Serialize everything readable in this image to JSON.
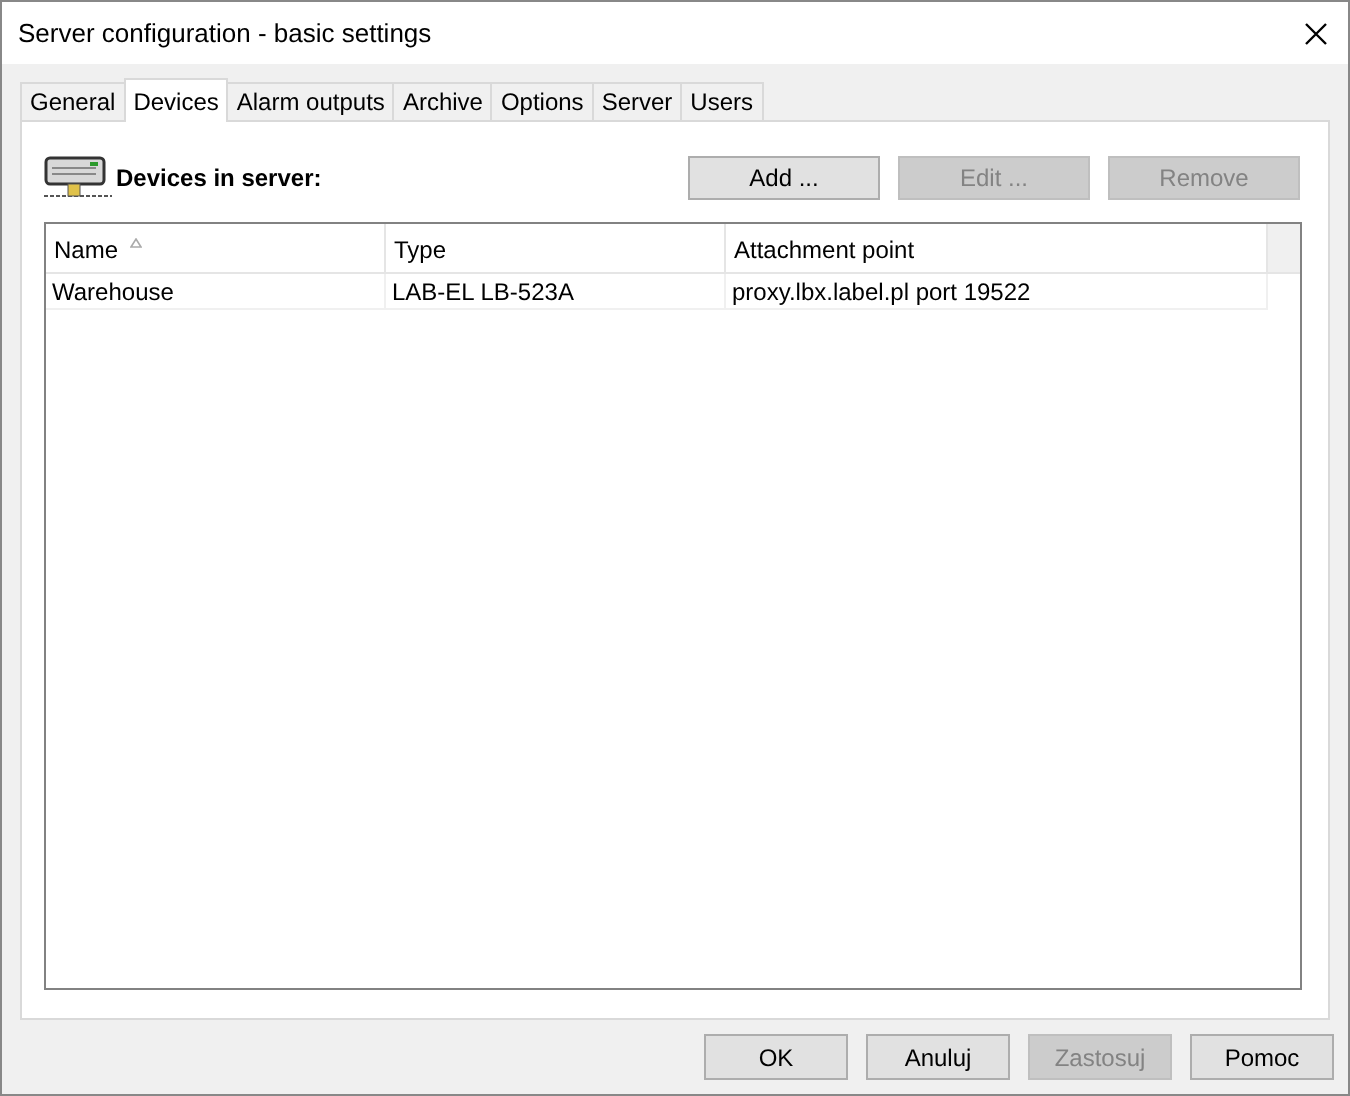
{
  "window": {
    "title": "Server configuration - basic settings"
  },
  "tabs": [
    {
      "label": "General",
      "selected": false
    },
    {
      "label": "Devices",
      "selected": true
    },
    {
      "label": "Alarm outputs",
      "selected": false
    },
    {
      "label": "Archive",
      "selected": false
    },
    {
      "label": "Options",
      "selected": false
    },
    {
      "label": "Server",
      "selected": false
    },
    {
      "label": "Users",
      "selected": false
    }
  ],
  "section_label": "Devices in server:",
  "actions": [
    {
      "label": "Add ...",
      "disabled": false
    },
    {
      "label": "Edit ...",
      "disabled": true
    },
    {
      "label": "Remove",
      "disabled": true
    }
  ],
  "table": {
    "columns": [
      {
        "label": "Name",
        "sorted": true
      },
      {
        "label": "Type",
        "sorted": false
      },
      {
        "label": "Attachment point",
        "sorted": false
      }
    ],
    "rows": [
      [
        "Warehouse",
        "LAB-EL LB-523A",
        "proxy.lbx.label.pl port 19522"
      ]
    ]
  },
  "buttons": [
    {
      "label": "OK",
      "disabled": false
    },
    {
      "label": "Anuluj",
      "disabled": false
    },
    {
      "label": "Zastosuj",
      "disabled": true
    },
    {
      "label": "Pomoc",
      "disabled": false
    }
  ]
}
